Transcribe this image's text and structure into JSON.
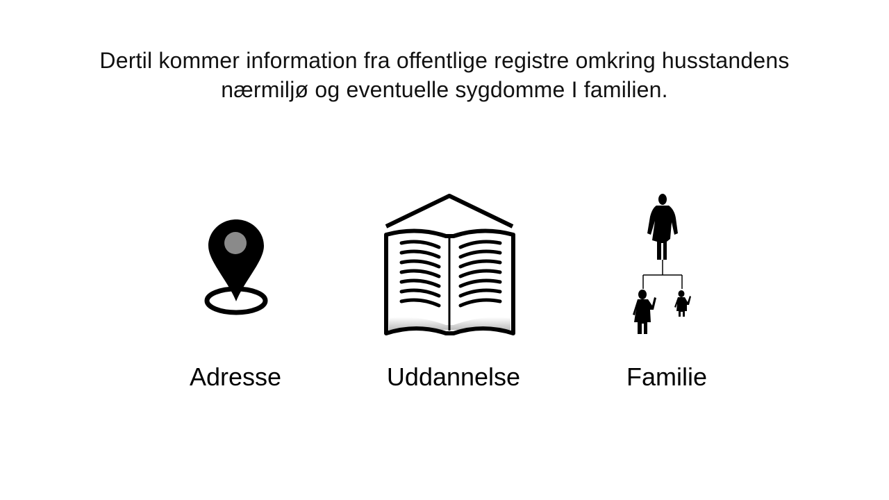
{
  "slide": {
    "body_lines": [
      "Dertil kommer information fra offentlige registre omkring husstandens",
      "nærmiljø og eventuelle sygdomme I familien."
    ],
    "items": [
      {
        "icon": "map-pin-icon",
        "label": "Adresse"
      },
      {
        "icon": "open-book-icon",
        "label": "Uddannelse"
      },
      {
        "icon": "family-tree-icon",
        "label": "Familie"
      }
    ]
  },
  "colors": {
    "background": "#ffffff",
    "icon_fill": "#000000",
    "pin_dot": "#8a8a8a"
  }
}
